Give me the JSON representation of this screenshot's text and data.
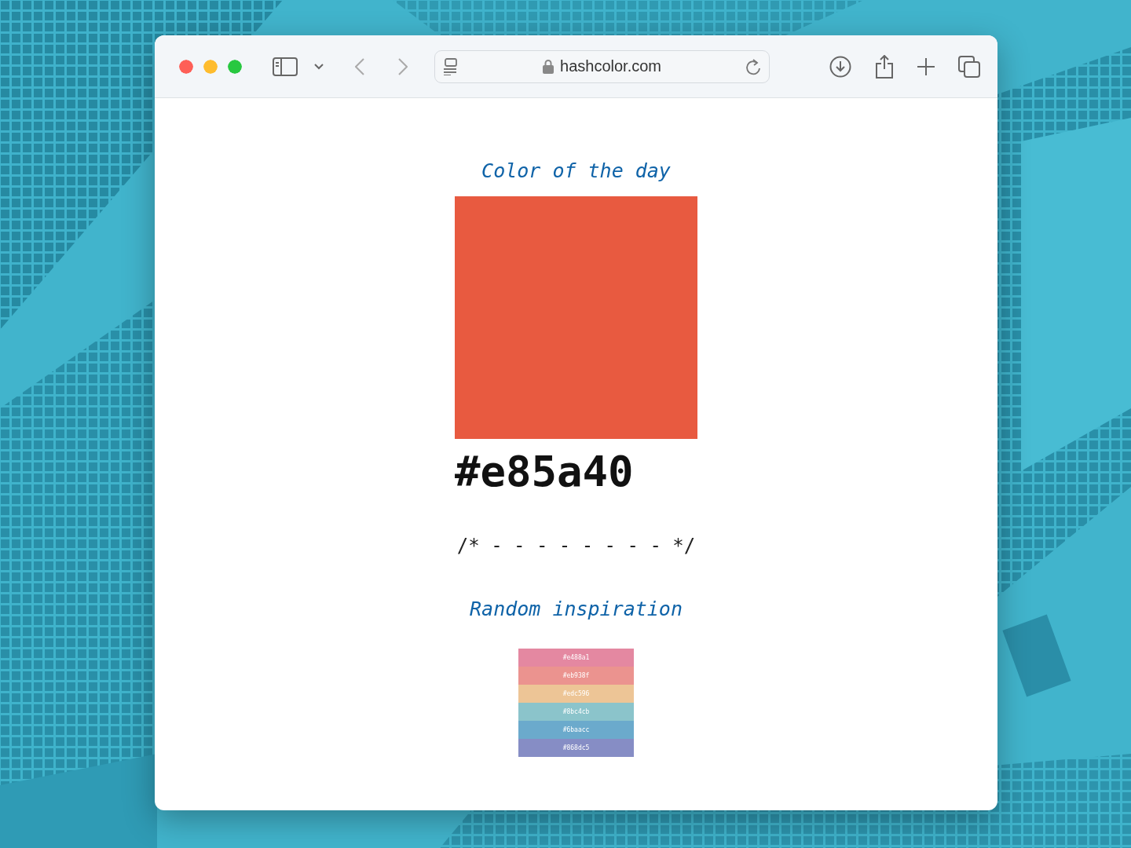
{
  "browser": {
    "address": "hashcolor.com"
  },
  "page": {
    "heading": "Color of the day",
    "color": "#e85a40",
    "hex": "#e85a40",
    "separator": "/* - - - - - - - - */",
    "subheading": "Random inspiration",
    "palette": [
      {
        "label": "#e488a1",
        "color": "#e488a1"
      },
      {
        "label": "#eb938f",
        "color": "#eb938f"
      },
      {
        "label": "#edc596",
        "color": "#edc596"
      },
      {
        "label": "#8bc4cb",
        "color": "#8bc4cb"
      },
      {
        "label": "#6baacc",
        "color": "#6baacc"
      },
      {
        "label": "#868dc5",
        "color": "#868dc5"
      }
    ]
  }
}
